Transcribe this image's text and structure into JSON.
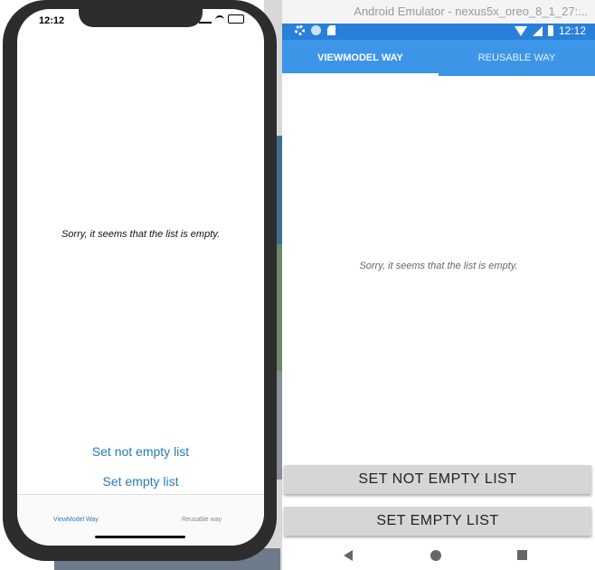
{
  "ios": {
    "time": "12:12",
    "empty_message": "Sorry, it seems that the list is empty.",
    "buttons": {
      "set_not_empty": "Set not empty list",
      "set_empty": "Set empty list"
    },
    "tabs": [
      {
        "label": "ViewModel Way",
        "active": true
      },
      {
        "label": "Reusable way",
        "active": false
      }
    ],
    "accent_color": "#2a7ab8"
  },
  "android": {
    "window_title": "Android Emulator - nexus5x_oreo_8_1_27:...",
    "time": "12:12",
    "tabs": [
      {
        "label": "VIEWMODEL WAY",
        "active": true
      },
      {
        "label": "REUSABLE WAY",
        "active": false
      }
    ],
    "empty_message": "Sorry, it seems that the list is empty.",
    "buttons": {
      "set_not_empty": "SET NOT EMPTY LIST",
      "set_empty": "SET EMPTY LIST"
    },
    "status_icons": [
      "gear-icon",
      "circle-icon",
      "sd-card-icon",
      "wifi-icon",
      "signal-icon",
      "battery-icon"
    ],
    "nav_icons": [
      "back-icon",
      "home-icon",
      "recents-icon"
    ],
    "colors": {
      "status_bar": "#2a7fd8",
      "tab_bar": "#3d95e8"
    }
  }
}
